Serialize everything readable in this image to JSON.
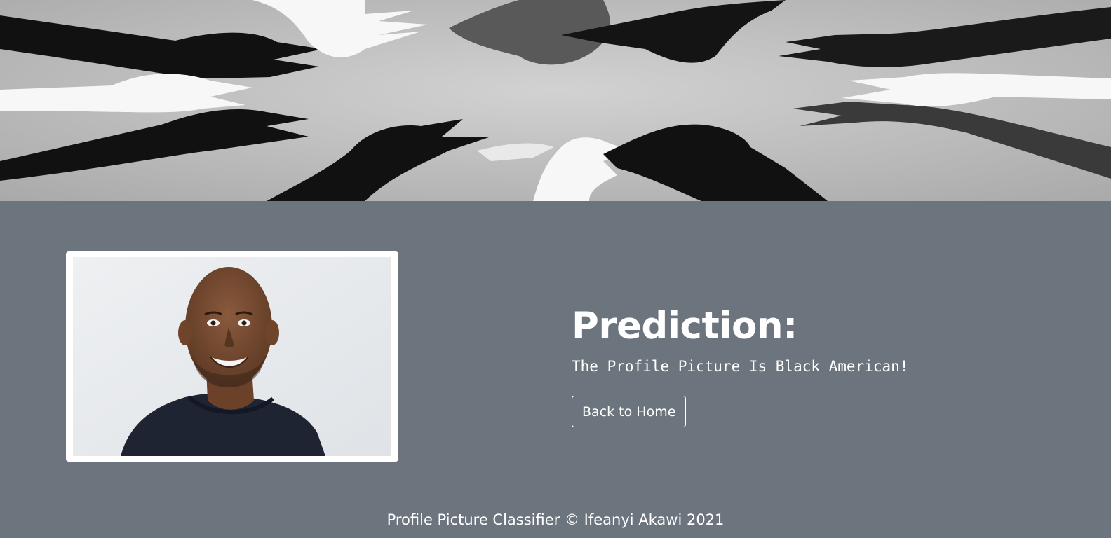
{
  "hero": {
    "image": "hands-reaching-circle-banner",
    "colors": {
      "ground": "#c4c4c4",
      "dark_hand": "#111111",
      "mid_hand": "#555555",
      "light_hand": "#f7f7f7"
    }
  },
  "main": {
    "background": "#6c757d",
    "photo": {
      "image": "profile-portrait-smiling-man"
    },
    "result": {
      "title": "Prediction:",
      "text": "The Profile Picture Is Black American!"
    },
    "back_button_label": "Back to Home"
  },
  "footer": {
    "text": "Profile Picture Classifier © Ifeanyi Akawi 2021"
  }
}
